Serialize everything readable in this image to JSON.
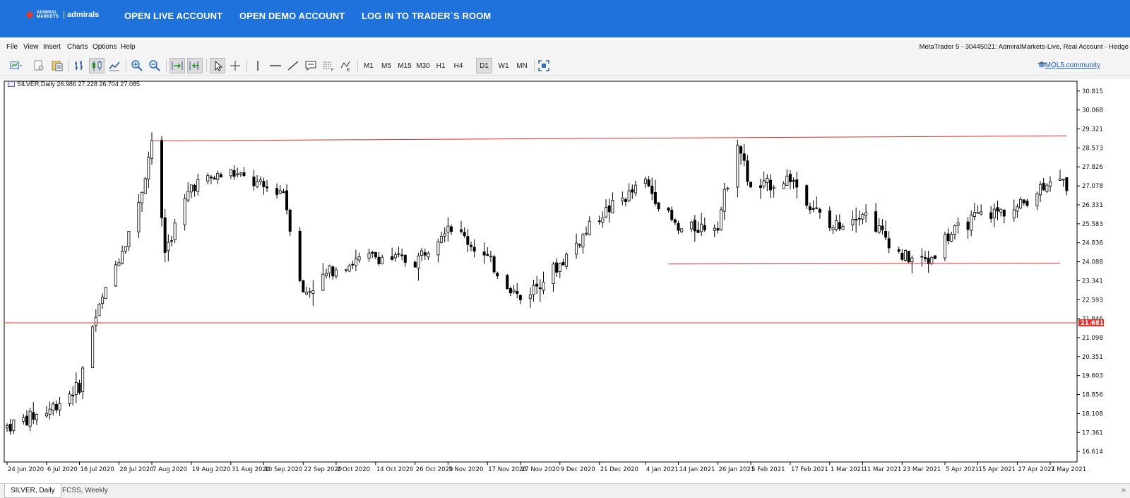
{
  "banner": {
    "logo_small": "ADMIRAL MARKETS",
    "logo_word": "admirals",
    "links": [
      "OPEN LIVE ACCOUNT",
      "OPEN DEMO ACCOUNT",
      "LOG IN TO TRADER`S ROOM"
    ]
  },
  "menu": {
    "items": [
      "File",
      "View",
      "Insert",
      "Charts",
      "Options",
      "Help"
    ],
    "window_title": "MetaTrader 5 - 30445021: AdmiralMarkets-Live, Real Account - Hedge"
  },
  "toolbar": {
    "timeframes": [
      "M1",
      "M5",
      "M15",
      "M30",
      "H1",
      "H4",
      "D1",
      "W1",
      "MN"
    ],
    "active_timeframe": "D1",
    "community_link": "MQL5.community"
  },
  "chart": {
    "header": "SILVER,Daily  26.986 27.228 26.704 27.085",
    "current_price_label": "21.681",
    "price_labels": [
      "30.815",
      "30.068",
      "29.321",
      "28.573",
      "27.826",
      "27.078",
      "26.331",
      "25.583",
      "24.836",
      "24.088",
      "23.341",
      "22.593",
      "21.846",
      "21.098",
      "20.351",
      "19.603",
      "18.856",
      "18.108",
      "17.361",
      "16.614"
    ],
    "date_labels": [
      "24 Jun 2020",
      "6 Jul 2020",
      "16 Jul 2020",
      "28 Jul 2020",
      "7 Aug 2020",
      "19 Aug 2020",
      "31 Aug 2020",
      "10 Sep 2020",
      "22 Sep 2020",
      "2 Oct 2020",
      "14 Oct 2020",
      "26 Oct 2020",
      "5 Nov 2020",
      "17 Nov 2020",
      "27 Nov 2020",
      "9 Dec 2020",
      "21 Dec 2020",
      "4 Jan 2021",
      "14 Jan 2021",
      "26 Jan 2021",
      "5 Feb 2021",
      "17 Feb 2021",
      "1 Mar 2021",
      "11 Mar 2021",
      "23 Mar 2021",
      "5 Apr 2021",
      "15 Apr 2021",
      "27 Apr 2021",
      "7 May 2021"
    ],
    "colors": {
      "line": "#e03030",
      "candle": "#000000",
      "price_tag": "#e03030"
    }
  },
  "chart_data": {
    "type": "candlestick",
    "symbol": "SILVER",
    "timeframe": "Daily",
    "last_ohlc": {
      "open": 26.986,
      "high": 27.228,
      "low": 26.704,
      "close": 27.085
    },
    "ylim": [
      16.2,
      31.2
    ],
    "close_path": [
      [
        "24 Jun 2020",
        17.6
      ],
      [
        "6 Jul 2020",
        18.2
      ],
      [
        "16 Jul 2020",
        19.2
      ],
      [
        "20 Jul 2020",
        21.6
      ],
      [
        "24 Jul 2020",
        22.9
      ],
      [
        "28 Jul 2020",
        24.3
      ],
      [
        "3 Aug 2020",
        26.3
      ],
      [
        "7 Aug 2020",
        28.9
      ],
      [
        "11 Aug 2020",
        24.5
      ],
      [
        "19 Aug 2020",
        27.1
      ],
      [
        "31 Aug 2020",
        27.6
      ],
      [
        "10 Sep 2020",
        27.0
      ],
      [
        "16 Sep 2020",
        26.9
      ],
      [
        "22 Sep 2020",
        22.8
      ],
      [
        "2 Oct 2020",
        23.9
      ],
      [
        "14 Oct 2020",
        24.3
      ],
      [
        "26 Oct 2020",
        24.1
      ],
      [
        "5 Nov 2020",
        25.6
      ],
      [
        "17 Nov 2020",
        24.2
      ],
      [
        "27 Nov 2020",
        22.6
      ],
      [
        "9 Dec 2020",
        24.0
      ],
      [
        "21 Dec 2020",
        25.9
      ],
      [
        "4 Jan 2021",
        27.2
      ],
      [
        "14 Jan 2021",
        25.3
      ],
      [
        "26 Jan 2021",
        25.6
      ],
      [
        "1 Feb 2021",
        28.9
      ],
      [
        "5 Feb 2021",
        26.9
      ],
      [
        "17 Feb 2021",
        27.4
      ],
      [
        "1 Mar 2021",
        25.4
      ],
      [
        "11 Mar 2021",
        26.1
      ],
      [
        "23 Mar 2021",
        24.3
      ],
      [
        "31 Mar 2021",
        24.1
      ],
      [
        "5 Apr 2021",
        25.0
      ],
      [
        "15 Apr 2021",
        25.9
      ],
      [
        "27 Apr 2021",
        26.2
      ],
      [
        "7 May 2021",
        27.4
      ],
      [
        "12 May 2021",
        27.1
      ]
    ],
    "horizontal_lines": [
      21.681
    ],
    "trend_lines": [
      {
        "from": [
          "7 Aug 2020",
          28.85
        ],
        "to": [
          "12 May 2021",
          29.05
        ]
      },
      {
        "from": [
          "11 Jan 2021",
          24.0
        ],
        "to": [
          "10 May 2021",
          24.03
        ]
      }
    ]
  },
  "tabs": [
    "SILVER, Daily",
    "FCSS, Weekly"
  ]
}
